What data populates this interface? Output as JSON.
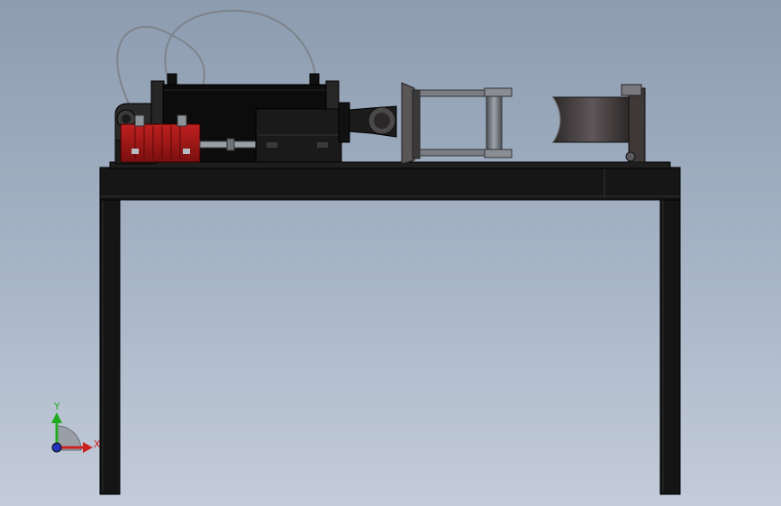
{
  "viewport": {
    "background_top": "#8d9cb0",
    "background_bottom": "#c3ccd9"
  },
  "triad": {
    "x_label": "X",
    "y_label": "Y",
    "x_color": "#cc2222",
    "y_color": "#22aa22",
    "z_color": "#2233bb"
  },
  "model": {
    "frame_color": "#141414",
    "cylinder_color": "#0c0c0c",
    "block_color": "#a01818",
    "metal_color": "#9aa0a8",
    "hose_color": "#7e848c"
  }
}
